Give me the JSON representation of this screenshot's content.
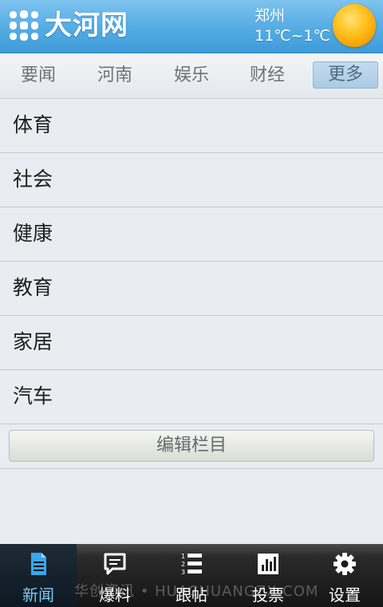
{
  "header": {
    "logo_text": "大河网",
    "city": "郑州",
    "temperature": "11℃~1℃",
    "weather_icon": "sun-icon"
  },
  "tabs": [
    {
      "label": "要闻",
      "active": false
    },
    {
      "label": "河南",
      "active": false
    },
    {
      "label": "娱乐",
      "active": false
    },
    {
      "label": "财经",
      "active": false
    },
    {
      "label": "更多",
      "active": true
    }
  ],
  "list": {
    "items": [
      "体育",
      "社会",
      "健康",
      "教育",
      "家居",
      "汽车"
    ],
    "edit_button": "编辑栏目"
  },
  "bottom_nav": [
    {
      "label": "新闻",
      "icon": "document-icon",
      "active": true
    },
    {
      "label": "爆料",
      "icon": "chat-bubble-icon",
      "active": false
    },
    {
      "label": "跟帖",
      "icon": "numbered-list-icon",
      "active": false
    },
    {
      "label": "投票",
      "icon": "bar-chart-icon",
      "active": false
    },
    {
      "label": "设置",
      "icon": "gear-icon",
      "active": false
    }
  ],
  "watermark": "华创资讯 • HUACHUANGZX.COM",
  "colors": {
    "header_blue": "#5ab0e6",
    "active_tab": "#a9cbe6",
    "active_nav_text": "#7fc8f5"
  }
}
